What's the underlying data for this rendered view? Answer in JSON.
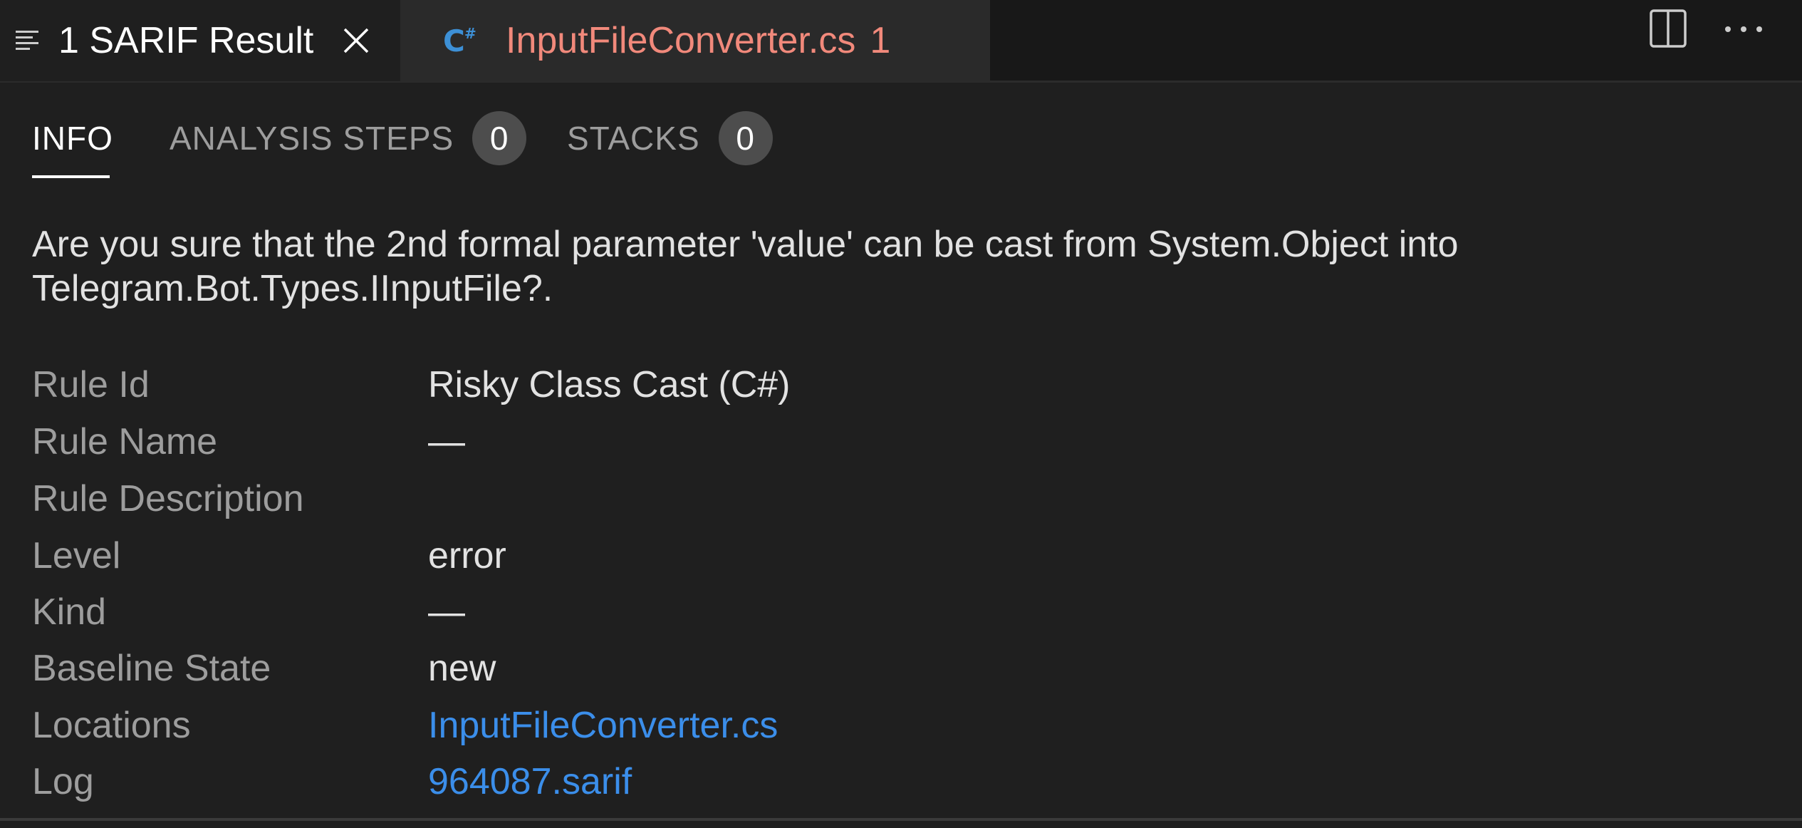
{
  "editor_tabs": [
    {
      "title": "1 SARIF Result",
      "icon": "list-icon",
      "active": true
    },
    {
      "title": "InputFileConverter.cs",
      "icon": "csharp-icon",
      "problem_count": "1",
      "color": "#f1897b"
    }
  ],
  "panel_tabs": {
    "info": "INFO",
    "analysis_steps": "ANALYSIS STEPS",
    "analysis_steps_count": "0",
    "stacks": "STACKS",
    "stacks_count": "0"
  },
  "message": "Are you sure that the 2nd formal parameter 'value' can be cast from System.Object into Telegram.Bot.Types.IInputFile?.",
  "properties": [
    {
      "label": "Rule Id",
      "value": "Risky Class Cast (C#)"
    },
    {
      "label": "Rule Name",
      "value": "—"
    },
    {
      "label": "Rule Description",
      "value": ""
    },
    {
      "label": "Level",
      "value": "error"
    },
    {
      "label": "Kind",
      "value": "—"
    },
    {
      "label": "Baseline State",
      "value": "new"
    },
    {
      "label": "Locations",
      "value": "InputFileConverter.cs",
      "link": true
    },
    {
      "label": "Log",
      "value": "964087.sarif",
      "link": true
    }
  ],
  "colors": {
    "background": "#1f1f1f",
    "accent_link": "#3b8eea",
    "error_file": "#f1897b"
  }
}
